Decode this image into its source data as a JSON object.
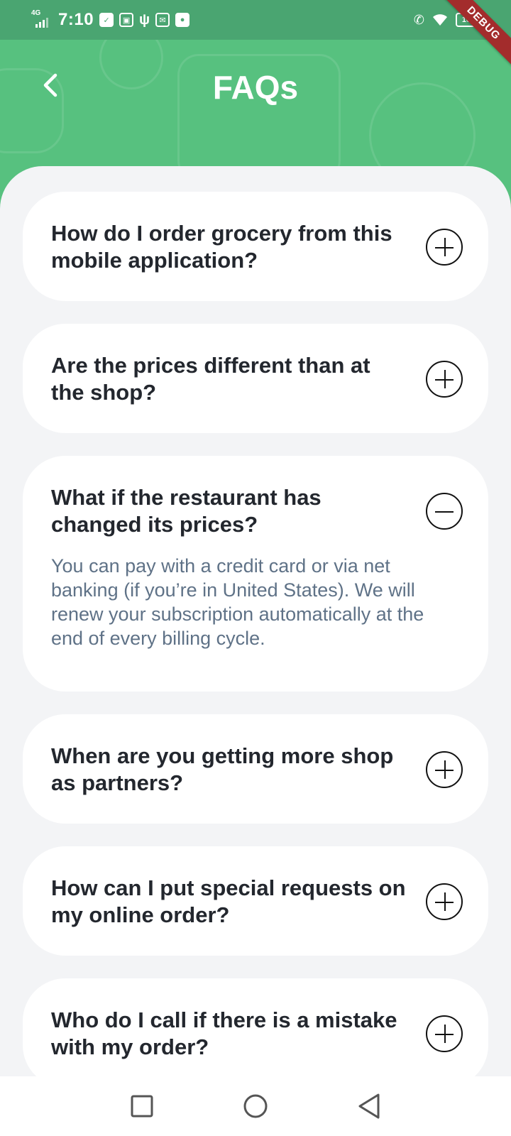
{
  "status_bar": {
    "network": "4G",
    "time": "7:10",
    "battery": "100"
  },
  "debug_banner": "DEBUG",
  "header": {
    "title": "FAQs"
  },
  "faqs": [
    {
      "question": "How do I order grocery from this mobile application?",
      "expanded": false,
      "answer": ""
    },
    {
      "question": "Are the prices different than at the shop?",
      "expanded": false,
      "answer": ""
    },
    {
      "question": "What if the restaurant has changed its prices?",
      "expanded": true,
      "answer": "You can pay with a credit card or via net banking (if you’re in United States). We will renew your subscription automatically at the end of every billing cycle."
    },
    {
      "question": "When are you getting more shop as partners?",
      "expanded": false,
      "answer": ""
    },
    {
      "question": "How can I put special requests on my online order?",
      "expanded": false,
      "answer": ""
    },
    {
      "question": "Who do I call if there is a mistake with my order?",
      "expanded": false,
      "answer": ""
    }
  ],
  "colors": {
    "header_green": "#57c17f",
    "status_green": "#4aa571",
    "question_text": "#23272e",
    "answer_text": "#5f7287"
  }
}
